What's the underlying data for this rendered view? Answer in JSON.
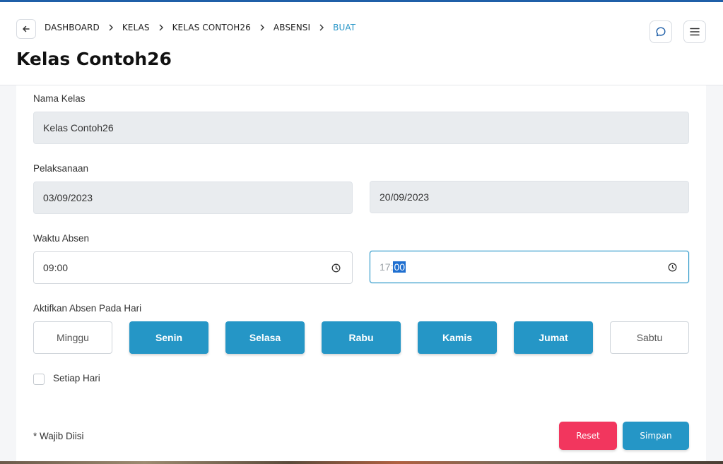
{
  "breadcrumb": [
    "DASHBOARD",
    "KELAS",
    "KELAS CONTOH26",
    "ABSENSI",
    "BUAT"
  ],
  "page_title": "Kelas Contoh26",
  "form": {
    "nama_kelas_label": "Nama Kelas",
    "nama_kelas_value": "Kelas Contoh26",
    "pelaksanaan_label": "Pelaksanaan",
    "start_date": "03/09/2023",
    "end_date": "20/09/2023",
    "waktu_label": "Waktu Absen",
    "start_time": "09:00",
    "end_time_hour": "17:",
    "end_time_minute": "00",
    "days_label": "Aktifkan Absen Pada Hari",
    "days": [
      {
        "label": "Minggu",
        "active": false
      },
      {
        "label": "Senin",
        "active": true
      },
      {
        "label": "Selasa",
        "active": true
      },
      {
        "label": "Rabu",
        "active": true
      },
      {
        "label": "Kamis",
        "active": true
      },
      {
        "label": "Jumat",
        "active": true
      },
      {
        "label": "Sabtu",
        "active": false
      }
    ],
    "every_day_label": "Setiap Hari",
    "required_note": "* Wajib Diisi",
    "reset_label": "Reset",
    "save_label": "Simpan"
  },
  "colors": {
    "accent": "#2596c6",
    "danger": "#f2365e",
    "topbar": "#1f5fa8"
  },
  "icons": {
    "back": "arrow-left-icon",
    "chat": "chat-bubble-icon",
    "menu": "hamburger-menu-icon",
    "clock": "clock-icon",
    "separator": "chevron-right-icon"
  }
}
